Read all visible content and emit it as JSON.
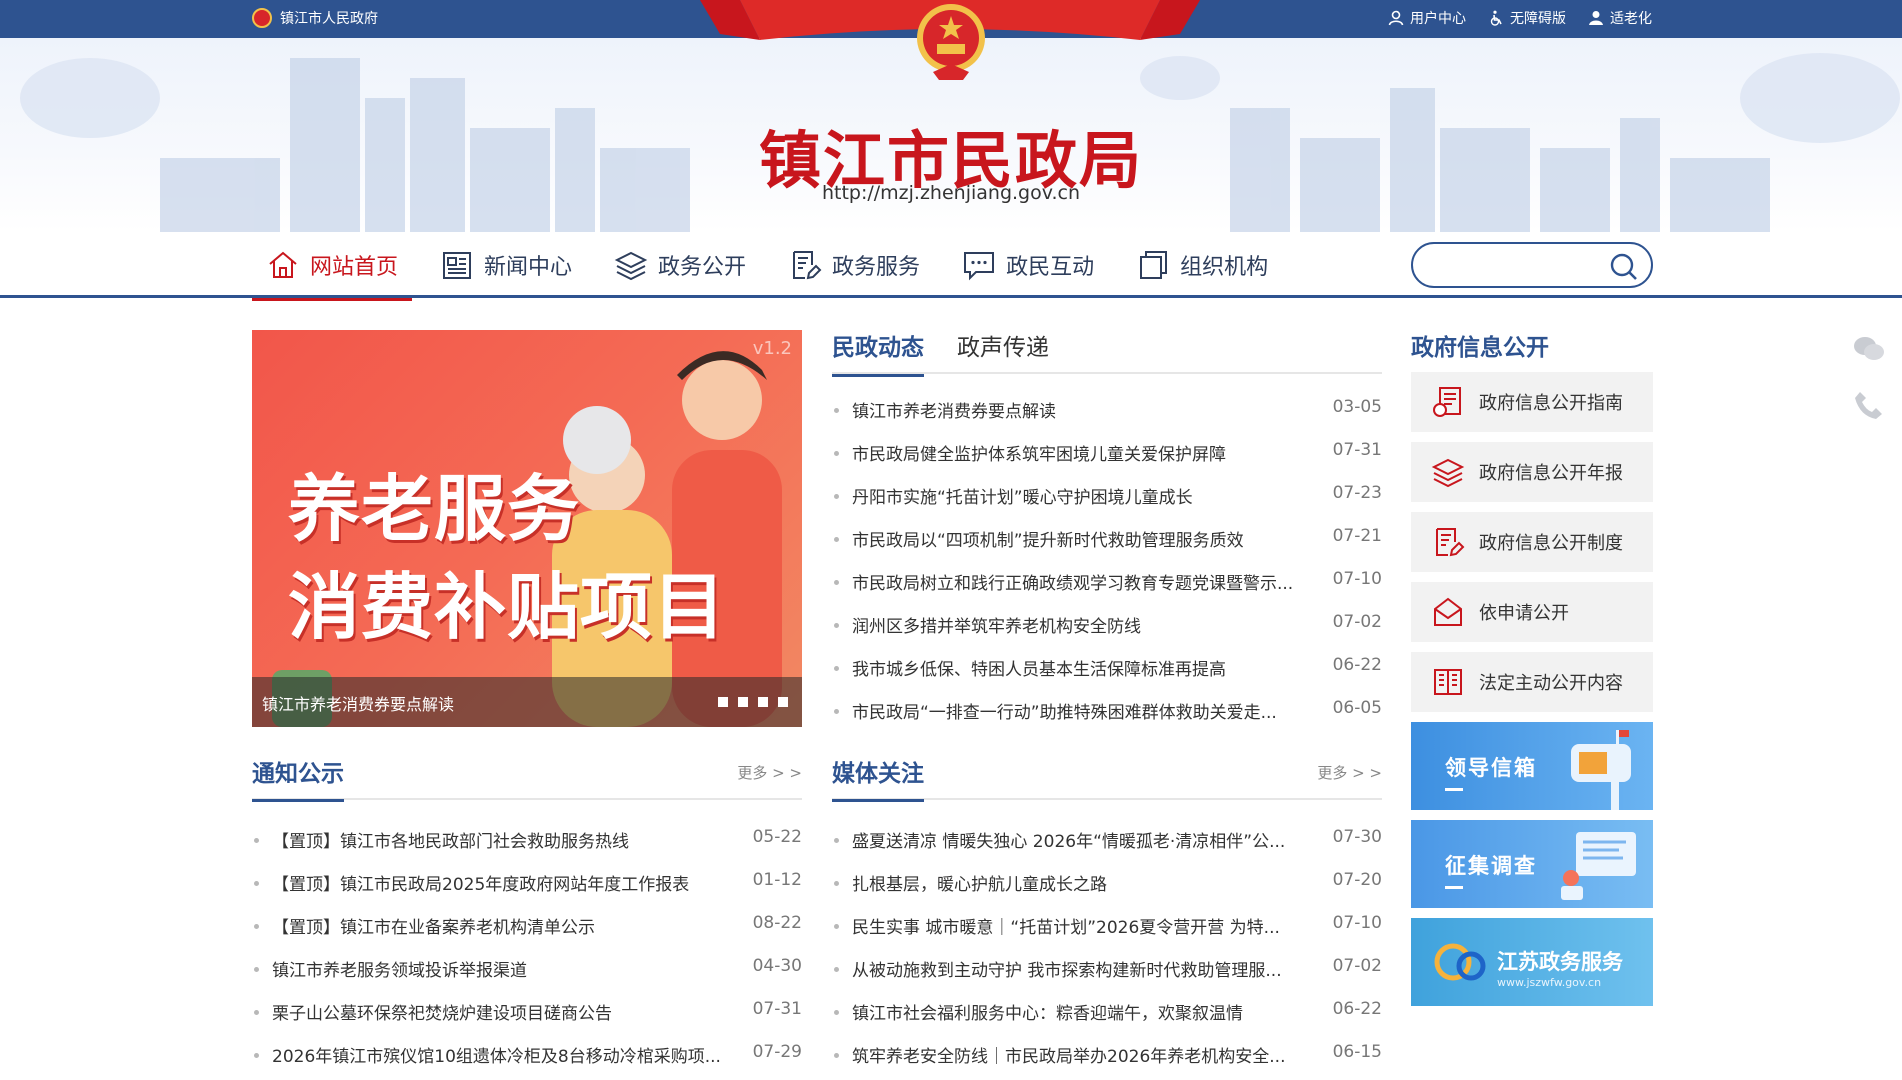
{
  "topbar": {
    "site_name": "镇江市人民政府",
    "links": [
      "用户中心",
      "无障碍版",
      "适老化"
    ]
  },
  "header": {
    "title": "镇江市民政局",
    "url": "http://mzj.zhenjiang.gov.cn"
  },
  "nav": {
    "items": [
      "网站首页",
      "新闻中心",
      "政务公开",
      "政务服务",
      "政民互动",
      "组织机构"
    ],
    "active_index": 0,
    "search_placeholder": ""
  },
  "carousel": {
    "headline_line1": "养老服务",
    "headline_line2": "消费补贴项目",
    "version": "v1.2",
    "caption": "镇江市养老消费券要点解读",
    "dot_count": 4
  },
  "news_tabs": {
    "tabs": [
      "民政动态",
      "政声传递"
    ],
    "active_index": 0,
    "items": [
      {
        "title": "镇江市养老消费券要点解读",
        "date": "03-05"
      },
      {
        "title": "市民政局健全监护体系筑牢困境儿童关爱保护屏障",
        "date": "07-31"
      },
      {
        "title": "丹阳市实施“托苗计划”暖心守护困境儿童成长",
        "date": "07-23"
      },
      {
        "title": "市民政局以“四项机制”提升新时代救助管理服务质效",
        "date": "07-21"
      },
      {
        "title": "市民政局树立和践行正确政绩观学习教育专题党课暨警示...",
        "date": "07-10"
      },
      {
        "title": "润州区多措并举筑牢养老机构安全防线",
        "date": "07-02"
      },
      {
        "title": "我市城乡低保、特困人员基本生活保障标准再提高",
        "date": "06-22"
      },
      {
        "title": "市民政局“一排查一行动”助推特殊困难群体救助关爱走...",
        "date": "06-05"
      }
    ]
  },
  "notices": {
    "heading": "通知公示",
    "more": "更多 > >",
    "items": [
      {
        "title": "【置顶】镇江市各地民政部门社会救助服务热线",
        "date": "05-22"
      },
      {
        "title": "【置顶】镇江市民政局2025年度政府网站年度工作报表",
        "date": "01-12"
      },
      {
        "title": "【置顶】镇江市在业备案养老机构清单公示",
        "date": "08-22"
      },
      {
        "title": "镇江市养老服务领域投诉举报渠道",
        "date": "04-30"
      },
      {
        "title": "栗子山公墓环保祭祀焚烧炉建设项目磋商公告",
        "date": "07-31"
      },
      {
        "title": "2026年镇江市殡仪馆10组遗体冷柜及8台移动冷棺采购项...",
        "date": "07-29"
      }
    ]
  },
  "media": {
    "heading": "媒体关注",
    "more": "更多 > >",
    "items": [
      {
        "title": "盛夏送清凉 情暖失独心 2026年“情暖孤老·清凉相伴”公...",
        "date": "07-30"
      },
      {
        "title": "扎根基层，暖心护航儿童成长之路",
        "date": "07-20"
      },
      {
        "title": "民生实事 城市暖意｜“托苗计划”2026夏令营开营 为特...",
        "date": "07-10"
      },
      {
        "title": "从被动施救到主动守护 我市探索构建新时代救助管理服...",
        "date": "07-02"
      },
      {
        "title": "镇江市社会福利服务中心：粽香迎端午，欢聚叙温情",
        "date": "06-22"
      },
      {
        "title": "筑牢养老安全防线｜市民政局举办2026年养老机构安全...",
        "date": "06-15"
      }
    ]
  },
  "sidebar": {
    "title": "政府信息公开",
    "items": [
      "政府信息公开指南",
      "政府信息公开年报",
      "政府信息公开制度",
      "依申请公开",
      "法定主动公开内容"
    ],
    "promos": [
      {
        "label": "领导信箱",
        "color": "#3d8fe0"
      },
      {
        "label": "征集调查",
        "color": "#4a97e6"
      },
      {
        "label": "江苏政务服务",
        "color": "#4aa6e3"
      }
    ],
    "promo_sub": "www.jszwfw.gov.cn"
  },
  "colors": {
    "primary": "#2e5390",
    "red": "#c8161d"
  }
}
